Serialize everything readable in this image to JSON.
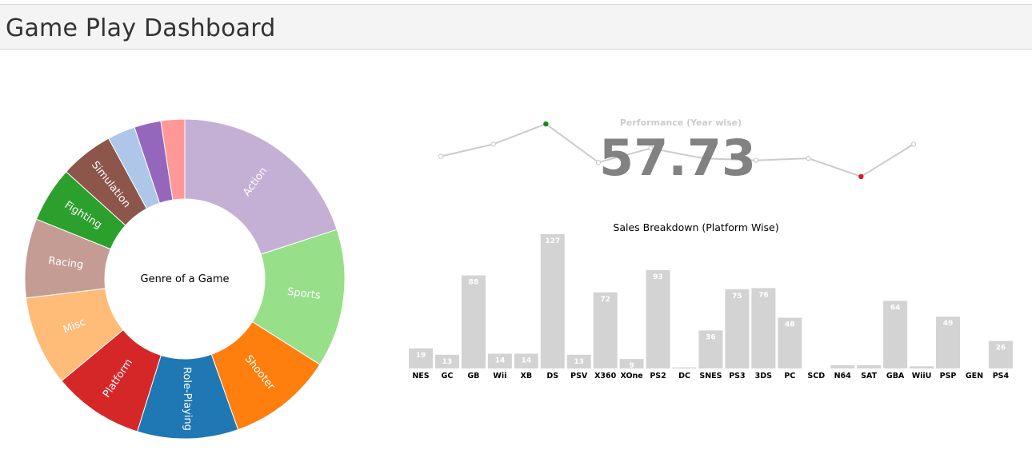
{
  "header": {
    "title": "Game Play Dashboard"
  },
  "colors": {
    "header_bg": "#f4f4f4",
    "bar": "#d3d3d3",
    "line": "#cccccc",
    "kpi": "#777777",
    "max_point": "#1a8a1a",
    "min_point": "#e8141c"
  },
  "chart_data": [
    {
      "type": "pie",
      "donut": true,
      "center_label": "Genre of a Game",
      "slices": [
        {
          "label": "Action",
          "value": 20.0,
          "color": "#c5b0d5"
        },
        {
          "label": "Sports",
          "value": 14.0,
          "color": "#98df8a"
        },
        {
          "label": "Shooter",
          "value": 10.6,
          "color": "#ff7f0e"
        },
        {
          "label": "Role-Playing",
          "value": 10.2,
          "color": "#1f77b4"
        },
        {
          "label": "Platform",
          "value": 9.2,
          "color": "#d62728"
        },
        {
          "label": "Misc",
          "value": 9.1,
          "color": "#ffbb78"
        },
        {
          "label": "Racing",
          "value": 8.0,
          "color": "#c49c94"
        },
        {
          "label": "Fighting",
          "value": 5.6,
          "color": "#2ca02c"
        },
        {
          "label": "Simulation",
          "value": 5.4,
          "color": "#8c564b"
        },
        {
          "label": "",
          "value": 2.8,
          "color": "#aec7e8"
        },
        {
          "label": "",
          "value": 2.7,
          "color": "#9467bd"
        },
        {
          "label": "",
          "value": 2.4,
          "color": "#ff9896"
        }
      ]
    },
    {
      "type": "line",
      "title": "Performance (Year wise)",
      "kpi": "57.73",
      "x": [
        1,
        2,
        3,
        4,
        5,
        6,
        7,
        8,
        9,
        10
      ],
      "values": [
        52,
        58,
        68,
        49,
        56,
        51,
        50,
        51,
        42,
        58
      ],
      "max_index": 2,
      "min_index": 8
    },
    {
      "type": "bar",
      "title": "Sales Breakdown (Platform Wise)",
      "categories": [
        "NES",
        "GC",
        "GB",
        "Wii",
        "XB",
        "DS",
        "PSV",
        "X360",
        "XOne",
        "PS2",
        "DC",
        "SNES",
        "PS3",
        "3DS",
        "PC",
        "SCD",
        "N64",
        "SAT",
        "GBA",
        "WiiU",
        "PSP",
        "GEN",
        "PS4"
      ],
      "values": [
        19,
        13,
        88,
        14,
        14,
        127,
        13,
        72,
        9,
        93,
        1,
        36,
        75,
        76,
        48,
        0,
        3,
        3,
        64,
        2,
        49,
        0,
        26
      ],
      "value_labels": [
        "19",
        "13",
        "88",
        "14",
        "14",
        "127",
        "13",
        "72",
        "9",
        "93",
        "",
        "36",
        "75",
        "76",
        "48",
        "",
        "",
        "",
        "64",
        "",
        "49",
        "",
        "26"
      ],
      "ylim": [
        0,
        127
      ]
    }
  ]
}
